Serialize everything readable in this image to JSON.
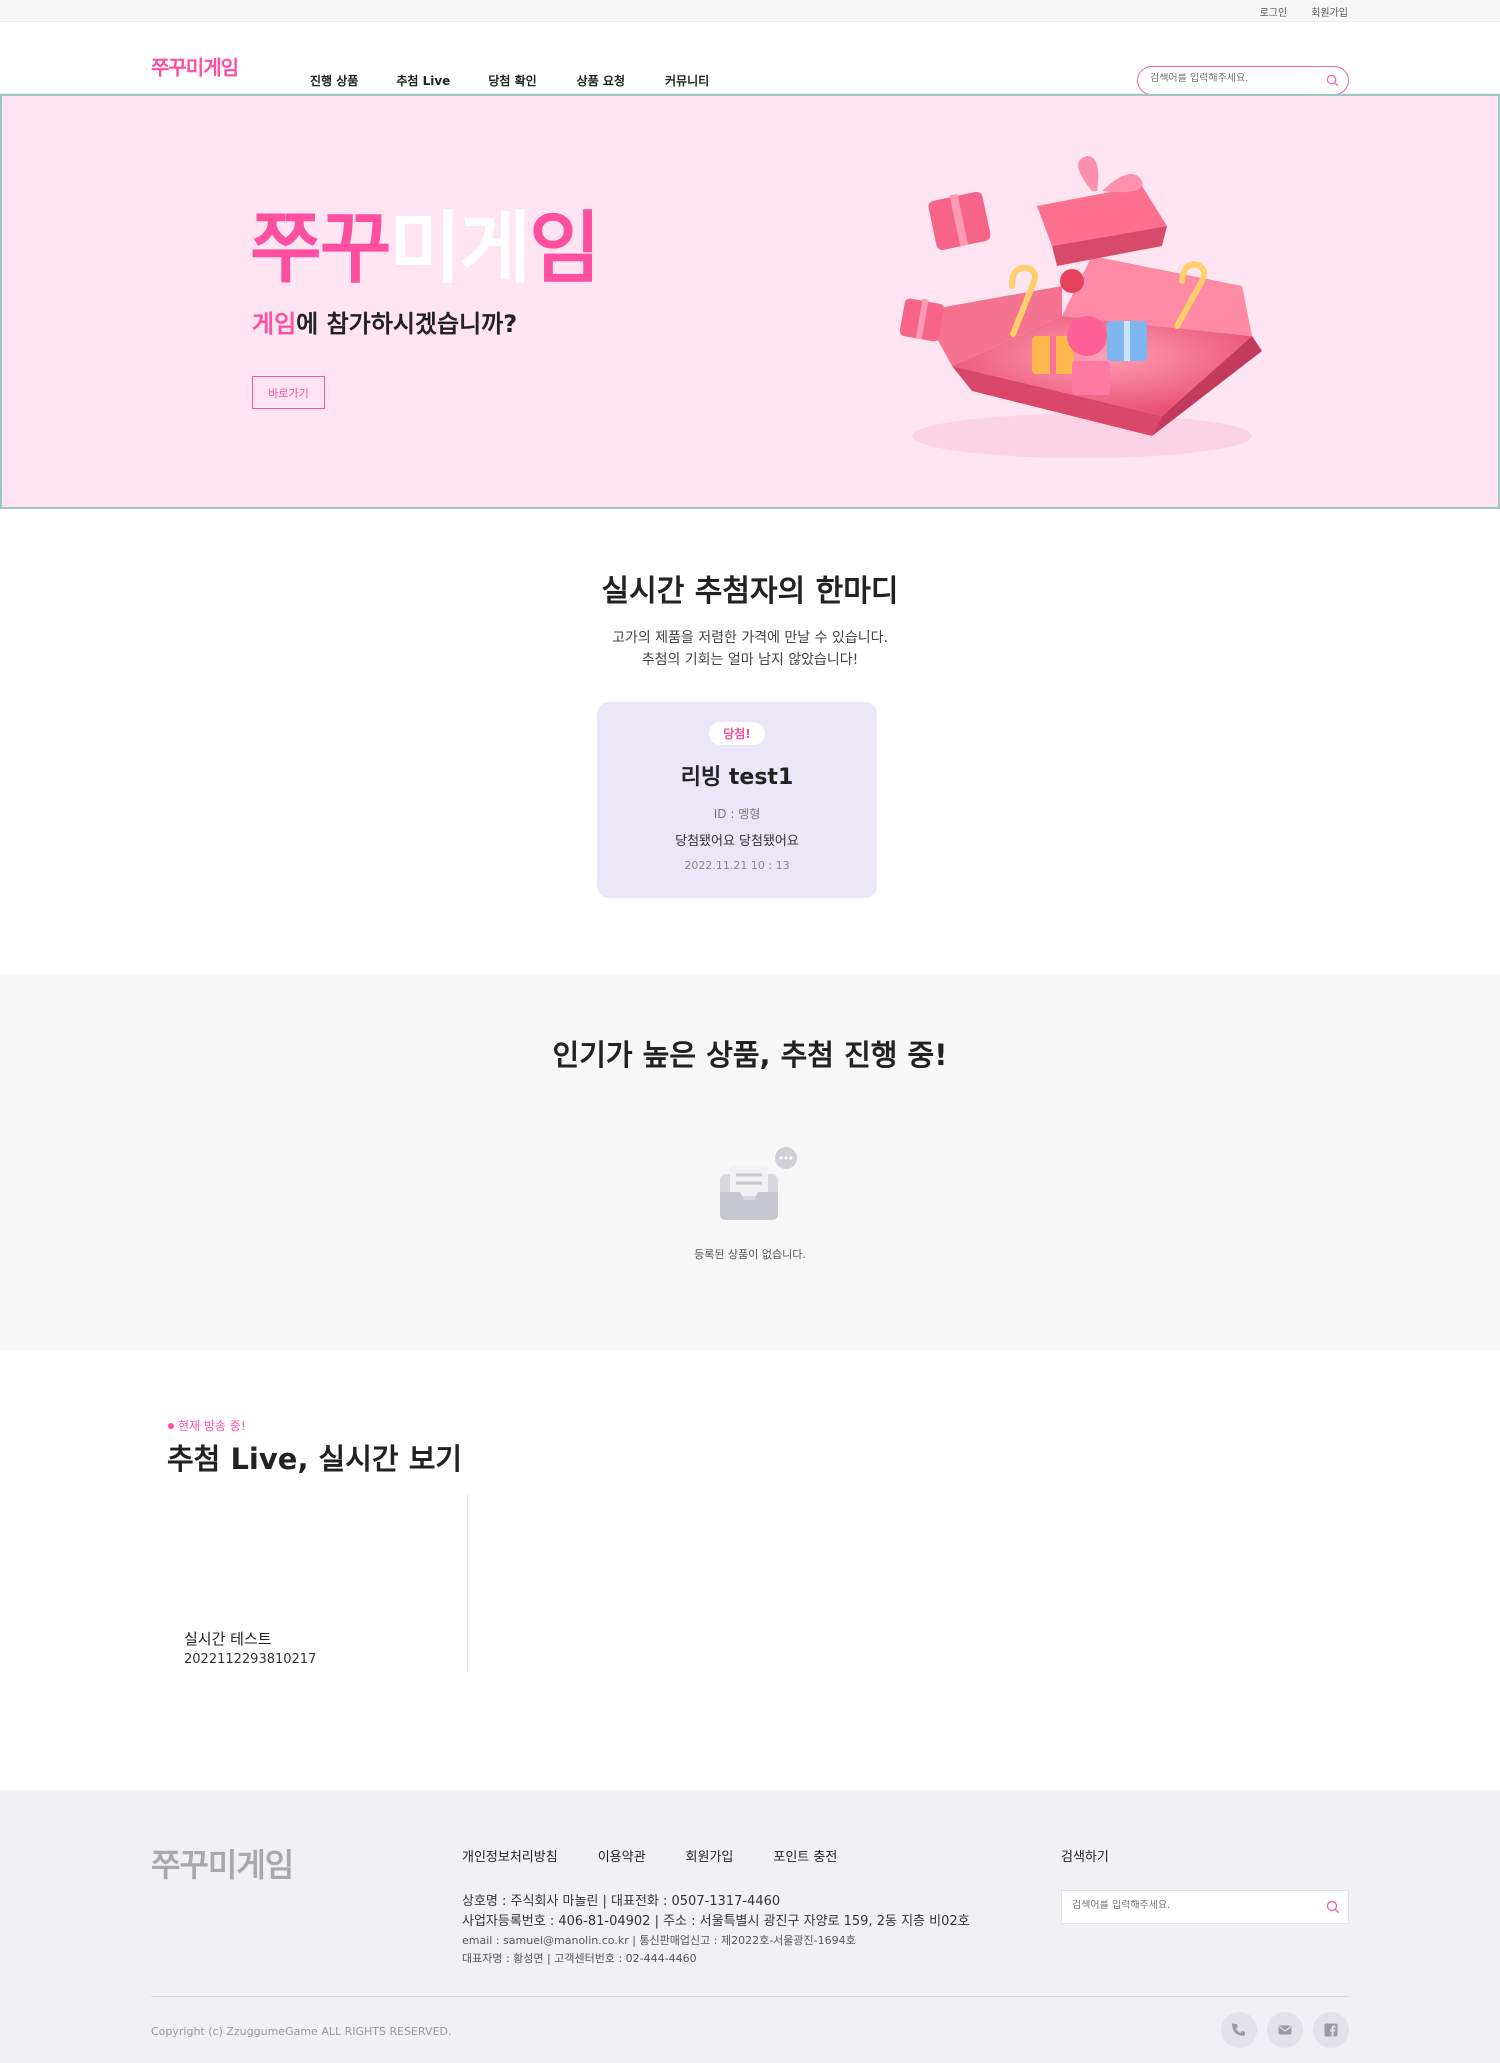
{
  "topbar": {
    "login": "로그인",
    "signup": "회원가입"
  },
  "header": {
    "logo": "쭈꾸미게임",
    "nav": [
      "진행 상품",
      "추첨 Live",
      "당첨 확인",
      "상품 요청",
      "커뮤니티"
    ],
    "search_placeholder": "검색어를 입력해주세요."
  },
  "hero": {
    "title_part1": "쭈꾸",
    "title_part2": "미게",
    "title_part3": "임",
    "subtitle_highlight": "게임",
    "subtitle_rest": "에 참가하시겠습니까?",
    "button": "바로가기"
  },
  "winners": {
    "title": "실시간 추첨자의 한마디",
    "desc_line1": "고가의 제품을 저렴한 가격에 만날 수 있습니다.",
    "desc_line2": "추첨의 기회는 얼마 남지 않았습니다!",
    "card": {
      "badge": "당첨!",
      "title": "리빙 test1",
      "id": "ID : 멩형",
      "message": "당첨됐어요 당첨됐어요",
      "date": "2022.11.21 10 : 13"
    }
  },
  "popular": {
    "title": "인기가 높은 상품, 추첨 진행 중!",
    "empty_text": "등록된 상품이 없습니다."
  },
  "live": {
    "badge": "현재 방송 중!",
    "title": "추첨 Live, 실시간 보기",
    "item_name": "실시간 테스트",
    "item_code": "2022112293810217"
  },
  "footer": {
    "logo": "쭈꾸미게임",
    "links": [
      "개인정보처리방침",
      "이용약관",
      "회원가입",
      "포인트 충전"
    ],
    "info_line1": "상호명 : 주식회사 마놀린  |  대표전화 : 0507-1317-4460",
    "info_line2": "사업자등록번호 : 406-81-04902  |  주소 : 서울특별시 광진구 자양로 159, 2동 지층 비02호",
    "info_line3": "email : samuel@manolin.co.kr  |  통신판매업신고 : 제2022호-서울광진-1694호",
    "info_line4": "대표자명 : 황성면  |  고객센터번호 : 02-444-4460",
    "search_label": "검색하기",
    "search_placeholder": "검색어를 입력해주세요.",
    "copyright": "Copyright (c) ZzuggumeGame ALL RIGHTS RESERVED.",
    "social_icons": [
      "phone-icon",
      "mail-icon",
      "facebook-icon"
    ]
  },
  "colors": {
    "accent": "#ff4fa1",
    "hero_bg": "#ffe4f1",
    "card_bg": "#ece6f9",
    "footer_bg": "#f1f1f5"
  }
}
